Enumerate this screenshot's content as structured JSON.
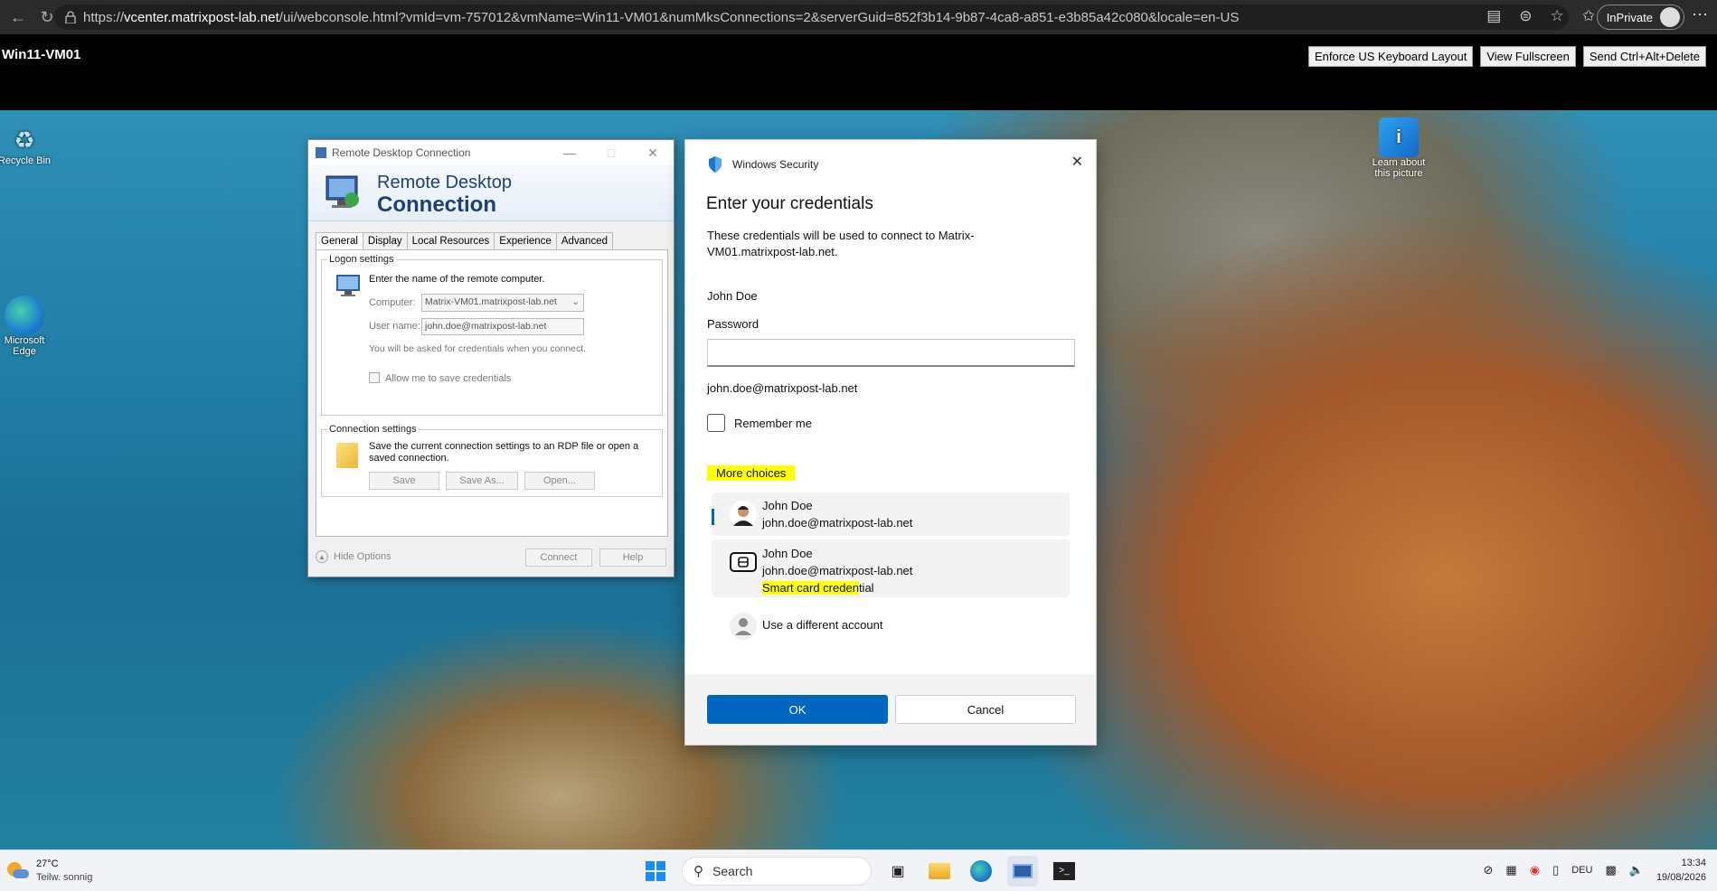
{
  "browser": {
    "url_scheme": "https://",
    "url_host": "vcenter.matrixpost-lab.net",
    "url_path": "/ui/webconsole.html?vmId=vm-757012&vmName=Win11-VM01&numMksConnections=2&serverGuid=852f3b14-9b87-4ca8-a851-e3b85a42c080&locale=en-US",
    "inprivate_label": "InPrivate"
  },
  "console": {
    "vm_name": "Win11-VM01",
    "buttons": [
      "Enforce US Keyboard Layout",
      "View Fullscreen",
      "Send Ctrl+Alt+Delete"
    ]
  },
  "desktop_icons": {
    "recycle_bin": "Recycle Bin",
    "edge_line1": "Microsoft",
    "edge_line2": "Edge",
    "learn_line1": "Learn about",
    "learn_line2": "this picture"
  },
  "rdc": {
    "title": "Remote Desktop Connection",
    "banner_line1": "Remote Desktop",
    "banner_line2": "Connection",
    "tabs": [
      "General",
      "Display",
      "Local Resources",
      "Experience",
      "Advanced"
    ],
    "logon_group": "Logon settings",
    "logon_intro": "Enter the name of the remote computer.",
    "computer_label": "Computer:",
    "computer_value": "Matrix-VM01.matrixpost-lab.net",
    "username_label": "User name:",
    "username_value": "john.doe@matrixpost-lab.net",
    "ask_note": "You will be asked for credentials when you connect.",
    "allow_save": "Allow me to save credentials",
    "conn_group": "Connection settings",
    "conn_text": "Save the current connection settings to an RDP file or open a saved connection.",
    "save": "Save",
    "save_as": "Save As...",
    "open": "Open...",
    "hide_options": "Hide Options",
    "connect": "Connect",
    "help": "Help"
  },
  "ws": {
    "header": "Windows Security",
    "title": "Enter your credentials",
    "description": "These credentials will be used to connect to Matrix-VM01.matrixpost-lab.net.",
    "user": "John Doe",
    "password_label": "Password",
    "email": "john.doe@matrixpost-lab.net",
    "remember": "Remember me",
    "more_choices": "More choices",
    "acct1_name": "John Doe",
    "acct1_email": "john.doe@matrixpost-lab.net",
    "acct2_name": "John Doe",
    "acct2_email": "john.doe@matrixpost-lab.net",
    "acct2_type_hl": "Smart card creden",
    "acct2_type_rest": "tial",
    "different_account": "Use a different account",
    "ok": "OK",
    "cancel": "Cancel",
    "accent": "#0067c0"
  },
  "taskbar": {
    "temp": "27°C",
    "weather": "Teilw. sonnig",
    "search": "Search",
    "lang": "DEU",
    "time": "13:34",
    "date": "19/08/2026"
  }
}
